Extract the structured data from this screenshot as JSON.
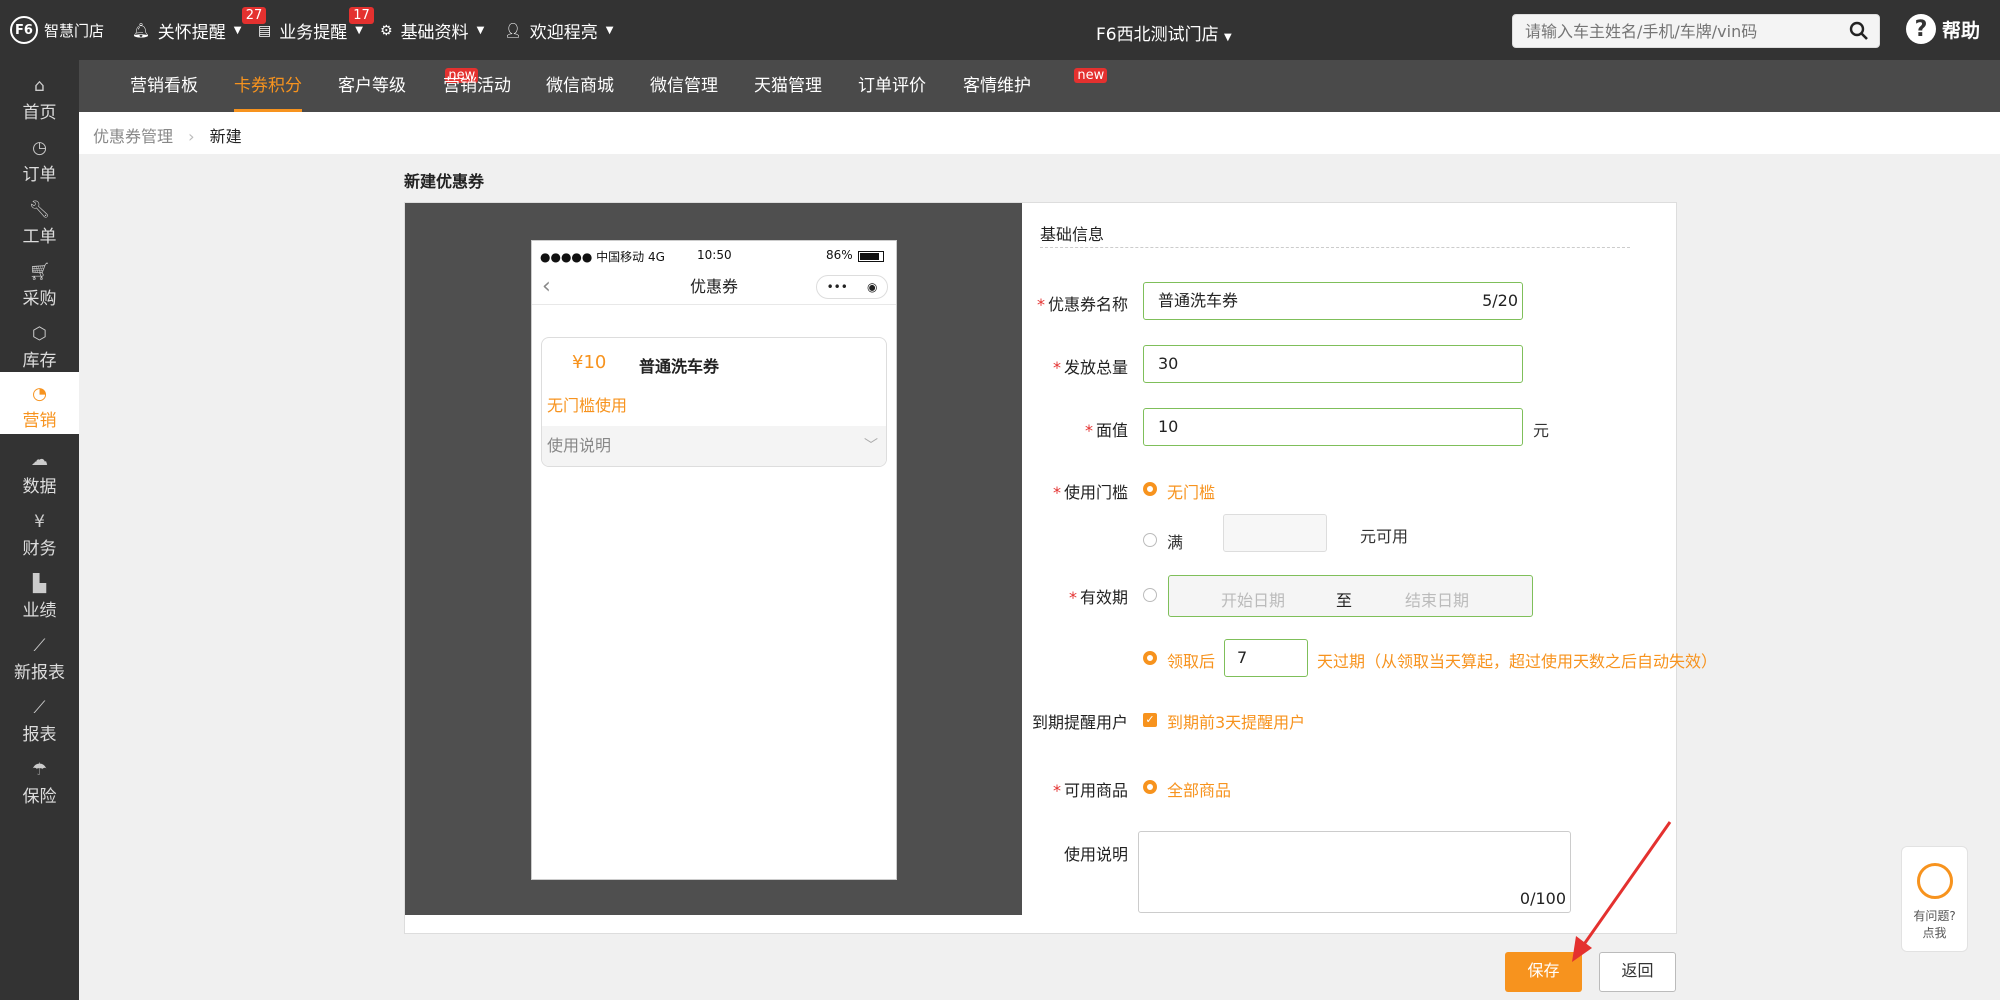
{
  "logo": {
    "text": "智慧门店"
  },
  "topbar": {
    "menus": [
      {
        "label": "关怀提醒",
        "badge": "27"
      },
      {
        "label": "业务提醒",
        "badge": "17"
      },
      {
        "label": "基础资料"
      },
      {
        "label": "欢迎程亮"
      }
    ],
    "store": "F6西北测试门店",
    "search_placeholder": "请输入车主姓名/手机/车牌/vin码",
    "help": "帮助"
  },
  "sidebar": {
    "items": [
      {
        "label": "首页",
        "icon": "home-icon"
      },
      {
        "label": "订单",
        "icon": "clock-icon"
      },
      {
        "label": "工单",
        "icon": "wrench-icon"
      },
      {
        "label": "采购",
        "icon": "cart-icon"
      },
      {
        "label": "库存",
        "icon": "box-icon"
      },
      {
        "label": "营销",
        "icon": "pie-icon",
        "active": true
      },
      {
        "label": "数据",
        "icon": "cloud-icon"
      },
      {
        "label": "财务",
        "icon": "yen-icon"
      },
      {
        "label": "业绩",
        "icon": "bar-chart-icon"
      },
      {
        "label": "新报表",
        "icon": "line-chart-icon"
      },
      {
        "label": "报表",
        "icon": "report-icon"
      },
      {
        "label": "保险",
        "icon": "umbrella-icon"
      }
    ]
  },
  "subnav": {
    "items": [
      {
        "label": "营销看板"
      },
      {
        "label": "卡券积分",
        "active": true
      },
      {
        "label": "客户等级",
        "tag": "new"
      },
      {
        "label": "营销活动"
      },
      {
        "label": "微信商城"
      },
      {
        "label": "微信管理"
      },
      {
        "label": "天猫管理"
      },
      {
        "label": "订单评价"
      },
      {
        "label": "客情维护",
        "tag": "new"
      }
    ]
  },
  "breadcrumb": {
    "parent": "优惠券管理",
    "current": "新建"
  },
  "page_title": "新建优惠券",
  "phone": {
    "carrier": "●●●●● 中国移动  4G",
    "time": "10:50",
    "battery": "86%",
    "title": "优惠券",
    "coupon": {
      "price": "¥10",
      "name": "普通洗车券",
      "condition": "无门槛使用",
      "desc_label": "使用说明"
    }
  },
  "form": {
    "section_title": "基础信息",
    "name": {
      "label": "优惠券名称",
      "value": "普通洗车券",
      "counter": "5/20"
    },
    "total": {
      "label": "发放总量",
      "value": "30"
    },
    "face_value": {
      "label": "面值",
      "value": "10",
      "unit": "元"
    },
    "threshold": {
      "label": "使用门槛",
      "option_none": "无门槛",
      "option_full": "满",
      "full_suffix": "元可用"
    },
    "validity": {
      "label": "有效期",
      "start_placeholder": "开始日期",
      "to": "至",
      "end_placeholder": "结束日期",
      "after_label": "领取后",
      "days": "7",
      "after_suffix": "天过期（从领取当天算起，超过使用天数之后自动失效）"
    },
    "remind": {
      "label": "到期提醒用户",
      "option": "到期前3天提醒用户"
    },
    "goods": {
      "label": "可用商品",
      "option": "全部商品"
    },
    "desc": {
      "label": "使用说明",
      "counter": "0/100"
    }
  },
  "buttons": {
    "save": "保存",
    "back": "返回"
  },
  "float_help": {
    "line1": "有问题?",
    "line2": "点我"
  },
  "colors": {
    "accent": "#f7931e",
    "topbar": "#333333",
    "subnav": "#4a4a4a",
    "valid_border": "#7fbf5a",
    "badge": "#e4312f"
  }
}
